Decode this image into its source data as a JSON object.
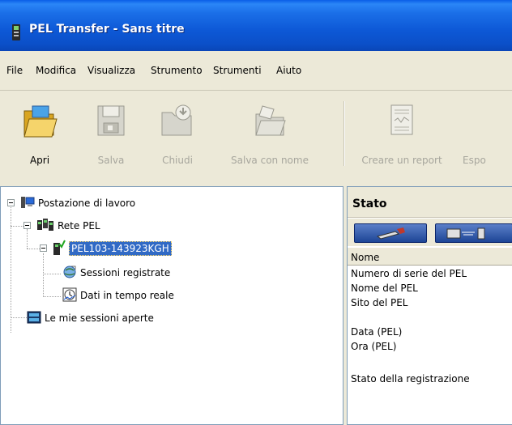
{
  "window": {
    "title": "PEL Transfer - Sans titre",
    "title_bar_color": "#0b50c9"
  },
  "menu": {
    "items": [
      "File",
      "Modifica",
      "Visualizza",
      "Strumento",
      "Strumenti",
      "Aiuto"
    ]
  },
  "toolbar": {
    "buttons": [
      {
        "label": "Apri",
        "icon": "open-folder-icon",
        "enabled": true
      },
      {
        "label": "Salva",
        "icon": "floppy-disk-icon",
        "enabled": false
      },
      {
        "label": "Chiudi",
        "icon": "close-folder-icon",
        "enabled": false
      },
      {
        "label": "Salva con nome",
        "icon": "save-as-folder-icon",
        "enabled": false
      },
      {
        "label": "Creare un report",
        "icon": "report-document-icon",
        "enabled": false
      },
      {
        "label": "Espo",
        "icon": "export-icon",
        "enabled": false
      }
    ]
  },
  "tree": {
    "root": "Postazione di lavoro",
    "network": "Rete PEL",
    "device": "PEL103-143923KGH",
    "sessions_recorded": "Sessioni registrate",
    "realtime_data": "Dati in tempo reale",
    "my_sessions": "Le mie sessioni aperte"
  },
  "status_panel": {
    "title": "Stato",
    "column_header": "Nome",
    "rows": [
      "Numero di serie del PEL",
      "Nome del PEL",
      "Sito del PEL",
      "",
      "Data (PEL)",
      "Ora (PEL)",
      "",
      "Stato della registrazione"
    ]
  }
}
